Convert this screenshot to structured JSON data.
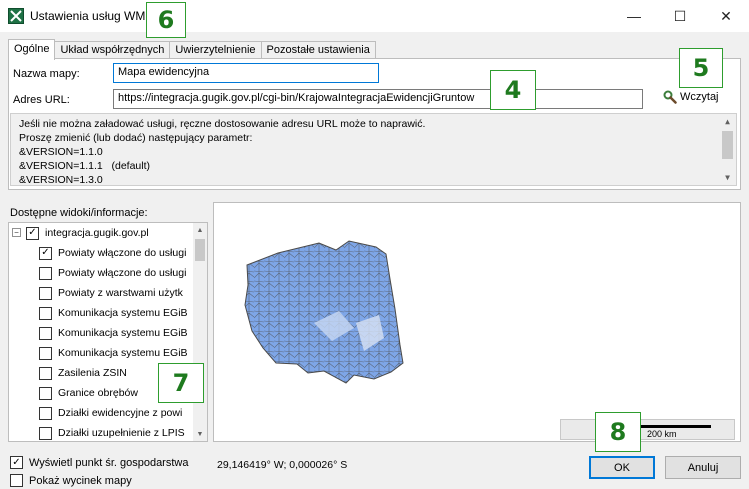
{
  "window": {
    "title": "Ustawienia usług WMS",
    "minimize_glyph": "—",
    "maximize_glyph": "☐",
    "close_glyph": "✕"
  },
  "tabs": [
    {
      "label": "Ogólne",
      "active": true
    },
    {
      "label": "Układ współrzędnych",
      "active": false
    },
    {
      "label": "Uwierzytelnienie",
      "active": false
    },
    {
      "label": "Pozostałe ustawienia",
      "active": false
    }
  ],
  "general": {
    "map_name_label": "Nazwa mapy:",
    "map_name_value": "Mapa ewidencyjna",
    "url_label": "Adres URL:",
    "url_value": "https://integracja.gugik.gov.pl/cgi-bin/KrajowaIntegracjaEwidencjiGruntow",
    "load_button": "Wczytaj",
    "message": "Jeśli nie można załadować usługi, ręczne dostosowanie adresu URL może to naprawić.\nProszę zmienić (lub dodać) następujący parametr:\n&VERSION=1.1.0\n&VERSION=1.1.1   (default)\n&VERSION=1.3.0"
  },
  "layers": {
    "label": "Dostępne widoki/informacje:",
    "root": {
      "label": "integracja.gugik.gov.pl",
      "checked": true,
      "expander": "−"
    },
    "items": [
      {
        "label": "Powiaty włączone do usługi",
        "checked": true
      },
      {
        "label": "Powiaty włączone do usługi",
        "checked": false
      },
      {
        "label": "Powiaty z warstwami użytk",
        "checked": false
      },
      {
        "label": "Komunikacja systemu EGiB",
        "checked": false
      },
      {
        "label": "Komunikacja systemu EGiB",
        "checked": false
      },
      {
        "label": "Komunikacja systemu EGiB",
        "checked": false
      },
      {
        "label": "Zasilenia ZSIN",
        "checked": false
      },
      {
        "label": "Granice obrębów",
        "checked": false
      },
      {
        "label": "Działki ewidencyjne z powi",
        "checked": false
      },
      {
        "label": "Działki uzupełnienie z LPIS",
        "checked": false
      }
    ]
  },
  "map": {
    "scale_label": "200 km",
    "fill_color": "#7ea6e8",
    "border_color": "#4a4a4a"
  },
  "bottom": {
    "show_point_label": "Wyświetl punkt śr. gospodarstwa",
    "show_point_checked": true,
    "show_clip_label": "Pokaż wycinek mapy",
    "show_clip_checked": false,
    "coords": "29,146419° W; 0,000026° S",
    "ok_label": "OK",
    "cancel_label": "Anuluj"
  },
  "badges": [
    "6",
    "4",
    "5",
    "7",
    "8"
  ],
  "colors": {
    "accent": "#0078d7",
    "badge_border": "#2e9d2e",
    "badge_text": "#1e7a1e"
  }
}
